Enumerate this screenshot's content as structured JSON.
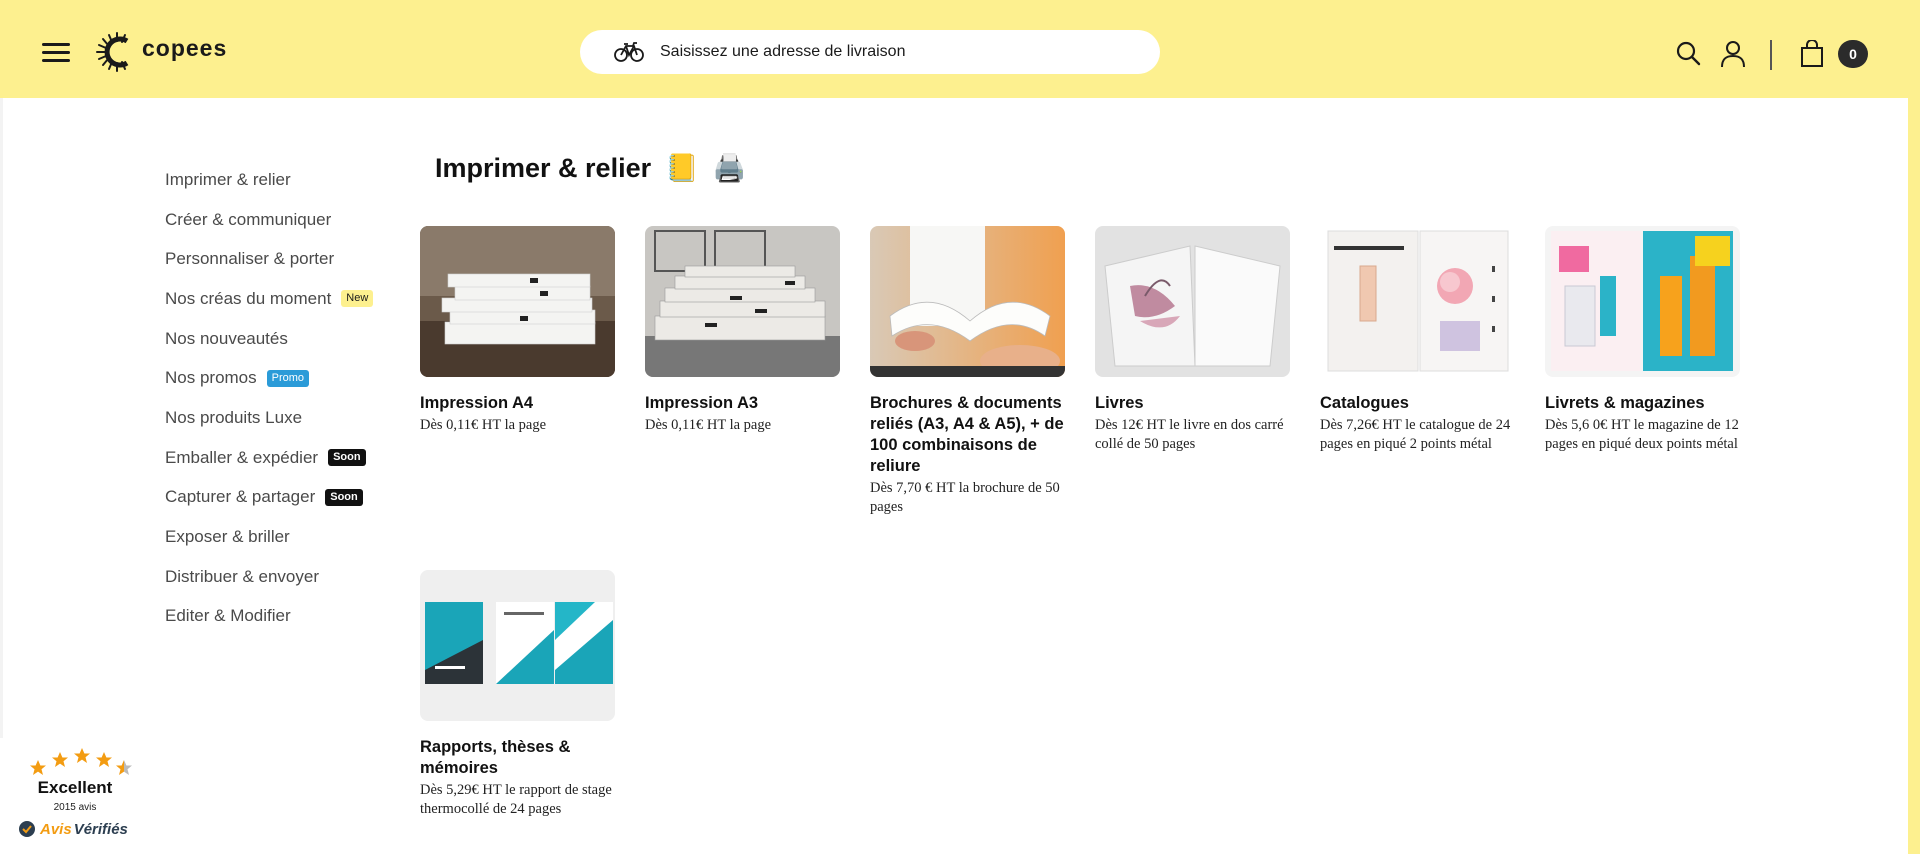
{
  "header": {
    "logo_text": "copees",
    "address_placeholder": "Saisissez une adresse de livraison",
    "cart_count": "0",
    "bg_color": "#fdf08f"
  },
  "sidebar": {
    "items": [
      {
        "label": "Imprimer & relier",
        "badge": ""
      },
      {
        "label": "Créer & communiquer",
        "badge": ""
      },
      {
        "label": "Personnaliser & porter",
        "badge": ""
      },
      {
        "label": "Nos créas du moment",
        "badge": "New"
      },
      {
        "label": "Nos nouveautés",
        "badge": ""
      },
      {
        "label": "Nos promos",
        "badge": "Promo"
      },
      {
        "label": "Nos produits Luxe",
        "badge": ""
      },
      {
        "label": "Emballer & expédier",
        "badge": "Soon"
      },
      {
        "label": "Capturer & partager",
        "badge": "Soon"
      },
      {
        "label": "Exposer & briller",
        "badge": ""
      },
      {
        "label": "Distribuer & envoyer",
        "badge": ""
      },
      {
        "label": "Editer & Modifier",
        "badge": ""
      }
    ]
  },
  "main": {
    "title": "Imprimer & relier",
    "title_emojis": [
      "📒",
      "🖨️"
    ],
    "products": [
      {
        "title": "Impression A4",
        "price": "Dès 0,11€ HT la page",
        "image": "stack-of-a4-papers"
      },
      {
        "title": "Impression A3",
        "price": "Dès 0,11€ HT la page",
        "image": "stack-of-a3-papers"
      },
      {
        "title": "Brochures & documents reliés (A3, A4 & A5), + de 100 combinaisons de reliure",
        "price": "Dès 7,70 € HT la brochure de 50 pages",
        "image": "hands-holding-brochure"
      },
      {
        "title": "Livres",
        "price": "Dès 12€ HT le livre en dos carré collé de 50 pages",
        "image": "open-book"
      },
      {
        "title": "Catalogues",
        "price": "Dès 7,26€ HT le catalogue de 24 pages en piqué 2 points métal",
        "image": "open-catalogue"
      },
      {
        "title": "Livrets & magazines",
        "price": "Dès 5,6 0€ HT le magazine de 12 pages en piqué deux points métal",
        "image": "open-magazine"
      },
      {
        "title": "Rapports, thèses & mémoires",
        "price": "Dès 5,29€ HT le rapport de stage thermocollé de 24 pages",
        "image": "business-report"
      }
    ]
  },
  "reviews": {
    "rating_label": "Excellent",
    "count_text": "2015 avis",
    "brand_part1": "Avis",
    "brand_part2": "Vérifiés",
    "stars": 4.5
  }
}
